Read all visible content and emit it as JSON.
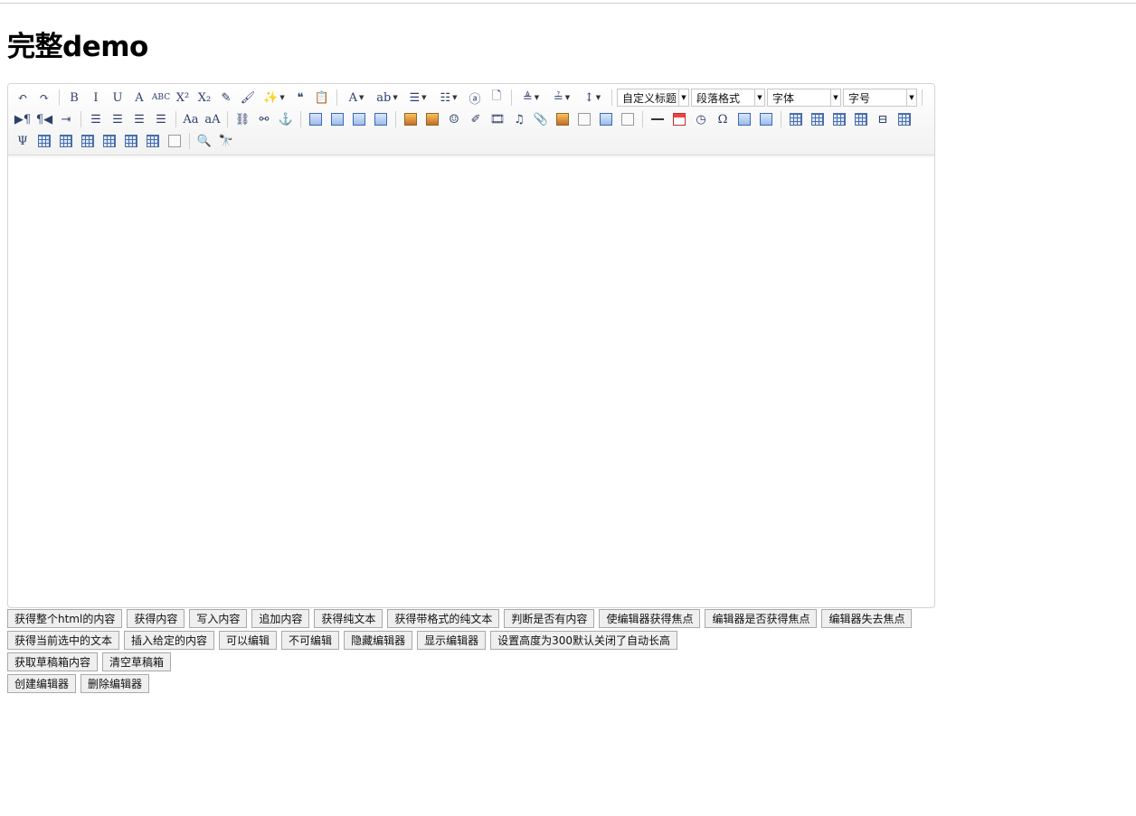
{
  "page": {
    "title": "完整demo"
  },
  "toolbar": {
    "row1": [
      {
        "name": "undo-icon",
        "glyph": "↶"
      },
      {
        "name": "redo-icon",
        "glyph": "↷"
      },
      {
        "sep": true
      },
      {
        "name": "bold-icon",
        "glyph": "B"
      },
      {
        "name": "italic-icon",
        "glyph": "I"
      },
      {
        "name": "underline-icon",
        "glyph": "U"
      },
      {
        "name": "font-border-icon",
        "glyph": "A"
      },
      {
        "name": "strikethrough-icon",
        "glyph": "ABC"
      },
      {
        "name": "superscript-icon",
        "glyph": "X²"
      },
      {
        "name": "subscript-icon",
        "glyph": "X₂"
      },
      {
        "name": "eraser-icon",
        "glyph": "✎"
      },
      {
        "name": "format-brush-icon",
        "glyph": "🖌"
      },
      {
        "name": "auto-typeset-icon",
        "glyph": "✨",
        "caret": true
      },
      {
        "name": "blockquote-icon",
        "glyph": "❝"
      },
      {
        "name": "paste-plain-icon",
        "glyph": "📋"
      },
      {
        "sep": true
      },
      {
        "name": "font-color-icon",
        "glyph": "A",
        "caret": true
      },
      {
        "name": "highlight-color-icon",
        "glyph": "ab",
        "caret": true
      },
      {
        "name": "ordered-list-icon",
        "glyph": "☰",
        "caret": true
      },
      {
        "name": "unordered-list-icon",
        "glyph": "☷",
        "caret": true
      },
      {
        "name": "select-all-icon",
        "glyph": "ⓐ"
      },
      {
        "name": "clear-doc-icon",
        "glyph": "🗋"
      },
      {
        "sep": true
      },
      {
        "name": "row-spacing-top-icon",
        "glyph": "≜",
        "caret": true
      },
      {
        "name": "row-spacing-bottom-icon",
        "glyph": "≟",
        "caret": true
      },
      {
        "name": "line-height-icon",
        "glyph": "↕",
        "caret": true
      }
    ],
    "dropdowns": [
      {
        "name": "custom-title-dropdown",
        "label": "自定义标题",
        "width": 80
      },
      {
        "name": "paragraph-dropdown",
        "label": "段落格式",
        "width": 82
      },
      {
        "name": "font-family-dropdown",
        "label": "字体",
        "width": 82
      },
      {
        "name": "font-size-dropdown",
        "label": "字号",
        "width": 82
      }
    ],
    "row2": [
      {
        "name": "direction-ltr-icon",
        "glyph": "▶¶"
      },
      {
        "name": "direction-rtl-icon",
        "glyph": "¶◀"
      },
      {
        "name": "indent-icon",
        "glyph": "⇥"
      },
      {
        "sep": true
      },
      {
        "name": "justify-left-icon",
        "glyph": "☰"
      },
      {
        "name": "justify-center-icon",
        "glyph": "☰"
      },
      {
        "name": "justify-right-icon",
        "glyph": "☰"
      },
      {
        "name": "justify-full-icon",
        "glyph": "☰"
      },
      {
        "sep": true
      },
      {
        "name": "touppercase-icon",
        "glyph": "Aa"
      },
      {
        "name": "tolowercase-icon",
        "glyph": "aA"
      },
      {
        "sep": true
      },
      {
        "name": "link-icon",
        "glyph": "⛓"
      },
      {
        "name": "unlink-icon",
        "glyph": "⚯"
      },
      {
        "name": "anchor-icon",
        "glyph": "⚓"
      },
      {
        "sep": true
      },
      {
        "name": "image-none-icon",
        "type": "blue"
      },
      {
        "name": "image-left-icon",
        "type": "blue"
      },
      {
        "name": "image-right-icon",
        "type": "blue"
      },
      {
        "name": "image-center-icon",
        "type": "blue"
      },
      {
        "sep": true
      },
      {
        "name": "simple-upload-icon",
        "type": "img"
      },
      {
        "name": "insert-image-icon",
        "type": "img"
      },
      {
        "name": "emotion-icon",
        "glyph": "☺"
      },
      {
        "name": "scrawl-icon",
        "glyph": "✐"
      },
      {
        "name": "insert-video-icon",
        "glyph": "🎞"
      },
      {
        "name": "music-icon",
        "glyph": "♫"
      },
      {
        "name": "attachment-icon",
        "glyph": "📎"
      },
      {
        "name": "map-icon",
        "type": "img"
      },
      {
        "name": "insert-frame-icon",
        "type": "page"
      },
      {
        "name": "insert-code-icon",
        "type": "blue"
      },
      {
        "name": "webapp-icon",
        "type": "page"
      },
      {
        "sep": true
      },
      {
        "name": "horizontal-rule-icon",
        "type": "line"
      },
      {
        "name": "date-icon",
        "type": "cal"
      },
      {
        "name": "time-icon",
        "glyph": "◷"
      },
      {
        "name": "special-chars-icon",
        "glyph": "Ω"
      },
      {
        "name": "snapscreen-icon",
        "type": "blue"
      },
      {
        "name": "word-image-icon",
        "type": "blue"
      },
      {
        "sep": true
      },
      {
        "name": "insert-table-icon",
        "type": "grid"
      },
      {
        "name": "delete-table-icon",
        "type": "grid"
      },
      {
        "name": "insert-paragraph-before-table-icon",
        "type": "grid"
      },
      {
        "name": "insert-row-icon",
        "type": "grid"
      },
      {
        "name": "delete-row-icon",
        "glyph": "⊟"
      },
      {
        "name": "insert-col-icon",
        "type": "grid"
      }
    ],
    "row3": [
      {
        "name": "delete-col-icon",
        "glyph": "Ψ"
      },
      {
        "name": "merge-cells-icon",
        "type": "grid"
      },
      {
        "name": "merge-right-icon",
        "type": "grid"
      },
      {
        "name": "merge-down-icon",
        "type": "grid"
      },
      {
        "name": "split-to-cells-icon",
        "type": "grid"
      },
      {
        "name": "split-to-rows-icon",
        "type": "grid"
      },
      {
        "name": "split-to-cols-icon",
        "type": "grid"
      },
      {
        "name": "chart-icon",
        "type": "page"
      },
      {
        "sep": true
      },
      {
        "name": "print-preview-icon",
        "glyph": "🔍"
      },
      {
        "name": "search-replace-icon",
        "glyph": "🔭"
      }
    ]
  },
  "buttons": {
    "row1": [
      "获得整个html的内容",
      "获得内容",
      "写入内容",
      "追加内容",
      "获得纯文本",
      "获得带格式的纯文本",
      "判断是否有内容",
      "使编辑器获得焦点",
      "编辑器是否获得焦点",
      "编辑器失去焦点"
    ],
    "row2": [
      "获得当前选中的文本",
      "插入给定的内容",
      "可以编辑",
      "不可编辑",
      "隐藏编辑器",
      "显示编辑器",
      "设置高度为300默认关闭了自动长高"
    ],
    "row3": [
      "获取草稿箱内容",
      "清空草稿箱"
    ],
    "row4": [
      "创建编辑器",
      "删除编辑器"
    ]
  },
  "colors": {
    "toolbarIcon": "#2c3e6b",
    "border": "#d4d4d4",
    "buttonBg": "#efefef"
  }
}
